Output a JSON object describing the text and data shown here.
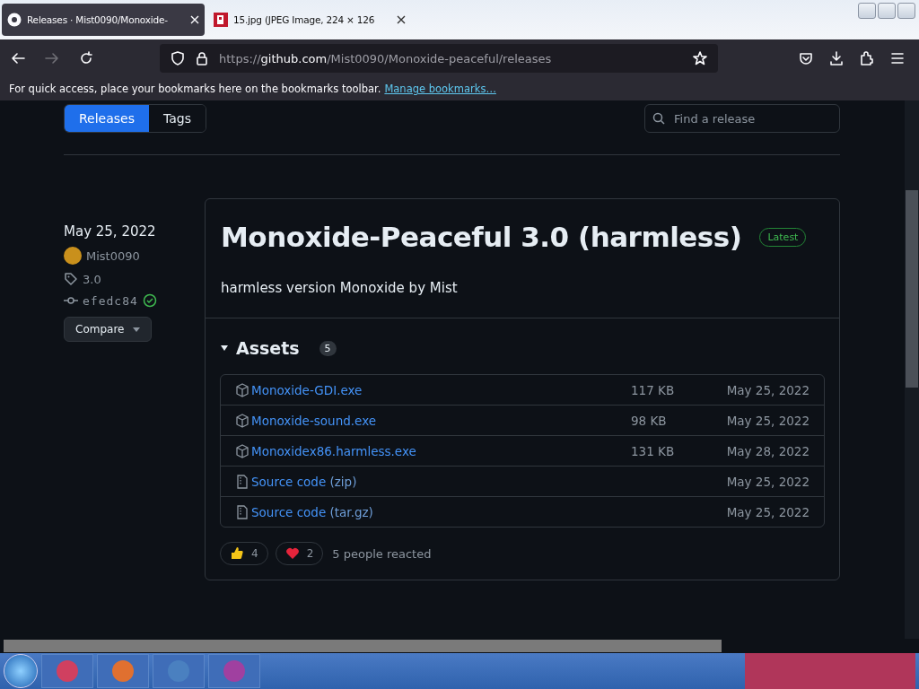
{
  "browser": {
    "tabs": [
      {
        "title": "Releases · Mist0090/Monoxide-",
        "selected": true
      },
      {
        "title": "15.jpg (JPEG Image, 224 × 126 ",
        "selected": false
      }
    ],
    "url": {
      "host": "github.com",
      "path": "/Mist0090/Monoxide-peaceful/releases",
      "scheme": "https://"
    },
    "bookmarks_bar": {
      "message": "For quick access, place your bookmarks here on the bookmarks toolbar.",
      "link": "Manage bookmarks…"
    }
  },
  "page": {
    "nav_tabs": [
      {
        "label": "Releases",
        "selected": true
      },
      {
        "label": "Tags",
        "selected": false
      }
    ],
    "search": {
      "placeholder": "Find a release"
    },
    "release": {
      "date": "May 25, 2022",
      "author": "Mist0090",
      "tag": "3.0",
      "commit": "efedc84",
      "verified": true,
      "compare_button": "Compare",
      "title": "Monoxide-Peaceful 3.0 (harmless)",
      "badge": "Latest",
      "description": "harmless version Monoxide by Mist",
      "assets": {
        "heading": "Assets",
        "count": "5",
        "expanded": true,
        "items": [
          {
            "kind": "binary",
            "name": "Monoxide-GDI.exe",
            "size": "117 KB",
            "date": "May 25, 2022"
          },
          {
            "kind": "binary",
            "name": "Monoxide-sound.exe",
            "size": "98 KB",
            "date": "May 25, 2022"
          },
          {
            "kind": "binary",
            "name": "Monoxidex86.harmless.exe",
            "size": "131 KB",
            "date": "May 28, 2022"
          },
          {
            "kind": "source",
            "name": "Source code",
            "suffix": "(zip)",
            "date": "May 25, 2022"
          },
          {
            "kind": "source",
            "name": "Source code",
            "suffix": "(tar.gz)",
            "date": "May 25, 2022"
          }
        ]
      },
      "reactions": [
        {
          "kind": "thumbs-up",
          "count": "4"
        },
        {
          "kind": "heart",
          "count": "2"
        }
      ],
      "reacted_text": "5 people reacted"
    }
  }
}
